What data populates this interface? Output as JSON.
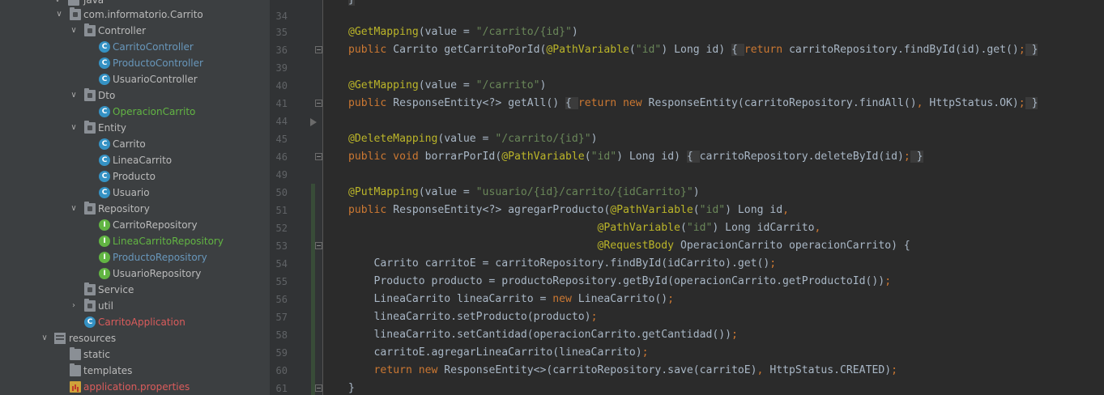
{
  "tree": {
    "top_label": "java",
    "items": [
      {
        "label": "com.informatorio.Carrito",
        "icon": "package-folder-icon",
        "arrow": "v",
        "color": "c-default"
      },
      {
        "label": "Controller",
        "icon": "package-folder-icon",
        "arrow": "v",
        "color": "c-default"
      },
      {
        "label": "CarritoController",
        "icon": "class-icon",
        "arrow": "",
        "color": "c-blue"
      },
      {
        "label": "ProductoController",
        "icon": "class-icon",
        "arrow": "",
        "color": "c-blue"
      },
      {
        "label": "UsuarioController",
        "icon": "class-icon",
        "arrow": "",
        "color": "c-default"
      },
      {
        "label": "Dto",
        "icon": "package-folder-icon",
        "arrow": "v",
        "color": "c-default"
      },
      {
        "label": "OperacionCarrito",
        "icon": "class-icon",
        "arrow": "",
        "color": "c-green"
      },
      {
        "label": "Entity",
        "icon": "package-folder-icon",
        "arrow": "v",
        "color": "c-default"
      },
      {
        "label": "Carrito",
        "icon": "class-icon",
        "arrow": "",
        "color": "c-default"
      },
      {
        "label": "LineaCarrito",
        "icon": "class-icon",
        "arrow": "",
        "color": "c-default"
      },
      {
        "label": "Producto",
        "icon": "class-icon",
        "arrow": "",
        "color": "c-default"
      },
      {
        "label": "Usuario",
        "icon": "class-icon",
        "arrow": "",
        "color": "c-default"
      },
      {
        "label": "Repository",
        "icon": "package-folder-icon",
        "arrow": "v",
        "color": "c-default"
      },
      {
        "label": "CarritoRepository",
        "icon": "interface-icon",
        "arrow": "",
        "color": "c-default"
      },
      {
        "label": "LineaCarritoRepository",
        "icon": "interface-icon",
        "arrow": "",
        "color": "c-green"
      },
      {
        "label": "ProductoRepository",
        "icon": "interface-icon",
        "arrow": "",
        "color": "c-blue"
      },
      {
        "label": "UsuarioRepository",
        "icon": "interface-icon",
        "arrow": "",
        "color": "c-default"
      },
      {
        "label": "Service",
        "icon": "package-folder-icon",
        "arrow": "",
        "color": "c-default"
      },
      {
        "label": "util",
        "icon": "package-folder-icon",
        "arrow": ">",
        "color": "c-default"
      },
      {
        "label": "CarritoApplication",
        "icon": "spring-app-icon",
        "arrow": "",
        "color": "c-red"
      },
      {
        "label": "resources",
        "icon": "resources-folder-icon",
        "arrow": "v",
        "color": "c-default"
      },
      {
        "label": "static",
        "icon": "folder-icon",
        "arrow": "",
        "color": "c-default"
      },
      {
        "label": "templates",
        "icon": "folder-icon",
        "arrow": "",
        "color": "c-default"
      },
      {
        "label": "application.properties",
        "icon": "properties-file-icon",
        "arrow": "",
        "color": "c-props"
      }
    ]
  },
  "editor": {
    "line_numbers": [
      "34",
      "35",
      "36",
      "39",
      "40",
      "41",
      "44",
      "45",
      "46",
      "49",
      "50",
      "51",
      "52",
      "53",
      "54",
      "55",
      "56",
      "57",
      "58",
      "59",
      "60",
      "61"
    ],
    "lines": [
      "<span class=\"brace\">}</span>",
      "<span class=\"ann\">@GetMapping</span>(value = <span class=\"str\">\"/carrito/{id}\"</span>)",
      "<span class=\"kw\">public</span> Carrito getCarritoPorId(<span class=\"ann\">@PathVariable</span>(<span class=\"str\">\"id\"</span>) Long id) <span class=\"brace\">{ </span><span class=\"kw\">return</span> carritoRepository.findById(id).get()<span class=\"kw\">;</span><span class=\"brace\"> }</span>",
      "",
      "<span class=\"ann\">@GetMapping</span>(value = <span class=\"str\">\"/carrito\"</span>)",
      "<span class=\"kw\">public</span> ResponseEntity&lt;?&gt; getAll() <span class=\"brace\">{ </span><span class=\"kw\">return new</span> ResponseEntity(carritoRepository.findAll()<span class=\"kw\">,</span> HttpStatus.OK)<span class=\"kw\">;</span><span class=\"brace\"> }</span>",
      "",
      "<span class=\"ann\">@DeleteMapping</span>(value = <span class=\"str\">\"/carrito/{id}\"</span>)",
      "<span class=\"kw\">public void</span> borrarPorId(<span class=\"ann\">@PathVariable</span>(<span class=\"str\">\"id\"</span>) Long id) <span class=\"brace\">{ </span>carritoRepository.deleteById(id)<span class=\"kw\">;</span><span class=\"brace\"> }</span>",
      "",
      "<span class=\"ann\">@PutMapping</span>(value = <span class=\"str\">\"usuario/{id}/carrito/{idCarrito}\"</span>)",
      "<span class=\"kw\">public</span> ResponseEntity&lt;?&gt; agregarProducto(<span class=\"ann\">@PathVariable</span>(<span class=\"str\">\"id\"</span>) Long id<span class=\"kw\">,</span>",
      "                                       <span class=\"ann\">@PathVariable</span>(<span class=\"str\">\"id\"</span>) Long idCarrito<span class=\"kw\">,</span>",
      "                                       <span class=\"ann\">@RequestBody</span> OperacionCarrito operacionCarrito) {",
      "    Carrito carritoE = carritoRepository.findById(idCarrito).get()<span class=\"kw\">;</span>",
      "    Producto producto = productoRepository.getById(operacionCarrito.getProductoId())<span class=\"kw\">;</span>",
      "    LineaCarrito lineaCarrito = <span class=\"kw\">new</span> LineaCarrito()<span class=\"kw\">;</span>",
      "    lineaCarrito.setProducto(producto)<span class=\"kw\">;</span>",
      "    lineaCarrito.setCantidad(operacionCarrito.getCantidad())<span class=\"kw\">;</span>",
      "    carritoE.agregarLineaCarrito(lineaCarrito)<span class=\"kw\">;</span>",
      "    <span class=\"kw\">return new</span> ResponseEntity&lt;&gt;(carritoRepository.save(carritoE)<span class=\"kw\">,</span> HttpStatus.CREATED)<span class=\"kw\">;</span>",
      "}"
    ]
  }
}
